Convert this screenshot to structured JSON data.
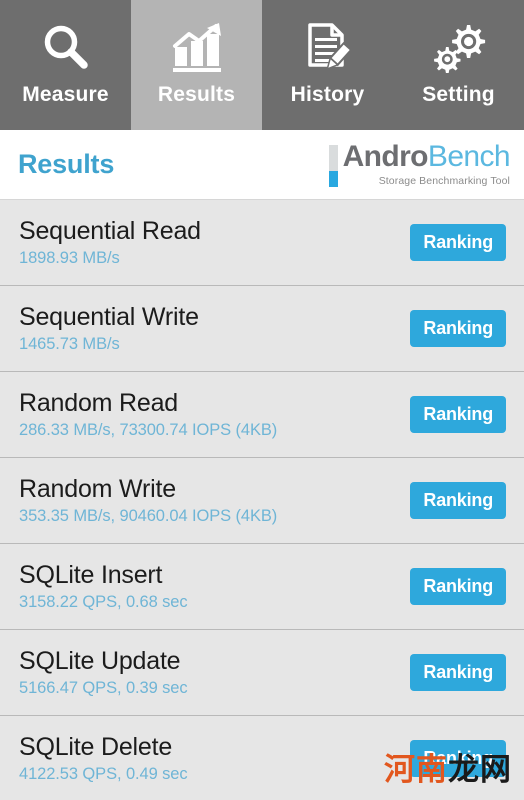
{
  "tabs": [
    {
      "label": "Measure",
      "icon": "magnifier-icon",
      "active": false
    },
    {
      "label": "Results",
      "icon": "bar-chart-icon",
      "active": true
    },
    {
      "label": "History",
      "icon": "document-pencil-icon",
      "active": false
    },
    {
      "label": "Setting",
      "icon": "gears-icon",
      "active": false
    }
  ],
  "header": {
    "title": "Results",
    "logo": {
      "name_dark": "Andro",
      "name_light": "Bench",
      "tagline": "Storage Benchmarking Tool"
    }
  },
  "results": [
    {
      "name": "Sequential Read",
      "value": "1898.93 MB/s",
      "button": "Ranking"
    },
    {
      "name": "Sequential Write",
      "value": "1465.73 MB/s",
      "button": "Ranking"
    },
    {
      "name": "Random Read",
      "value": "286.33 MB/s, 73300.74 IOPS (4KB)",
      "button": "Ranking"
    },
    {
      "name": "Random Write",
      "value": "353.35 MB/s, 90460.04 IOPS (4KB)",
      "button": "Ranking"
    },
    {
      "name": "SQLite Insert",
      "value": "3158.22 QPS, 0.68 sec",
      "button": "Ranking"
    },
    {
      "name": "SQLite Update",
      "value": "5166.47 QPS, 0.39 sec",
      "button": "Ranking"
    },
    {
      "name": "SQLite Delete",
      "value": "4122.53 QPS, 0.49 sec",
      "button": "Ranking"
    }
  ],
  "watermark": {
    "part_orange": "河南",
    "part_black": "龙网"
  },
  "colors": {
    "tabbar_bg": "#6e6e6e",
    "tab_active_bg": "#b4b4b4",
    "title_blue": "#3fa3ce",
    "value_blue": "#6fb5d6",
    "button_blue": "#2ea8dc",
    "list_bg": "#e6e6e6",
    "logo_dark": "#6d6e71",
    "logo_light": "#5bb8e0"
  }
}
